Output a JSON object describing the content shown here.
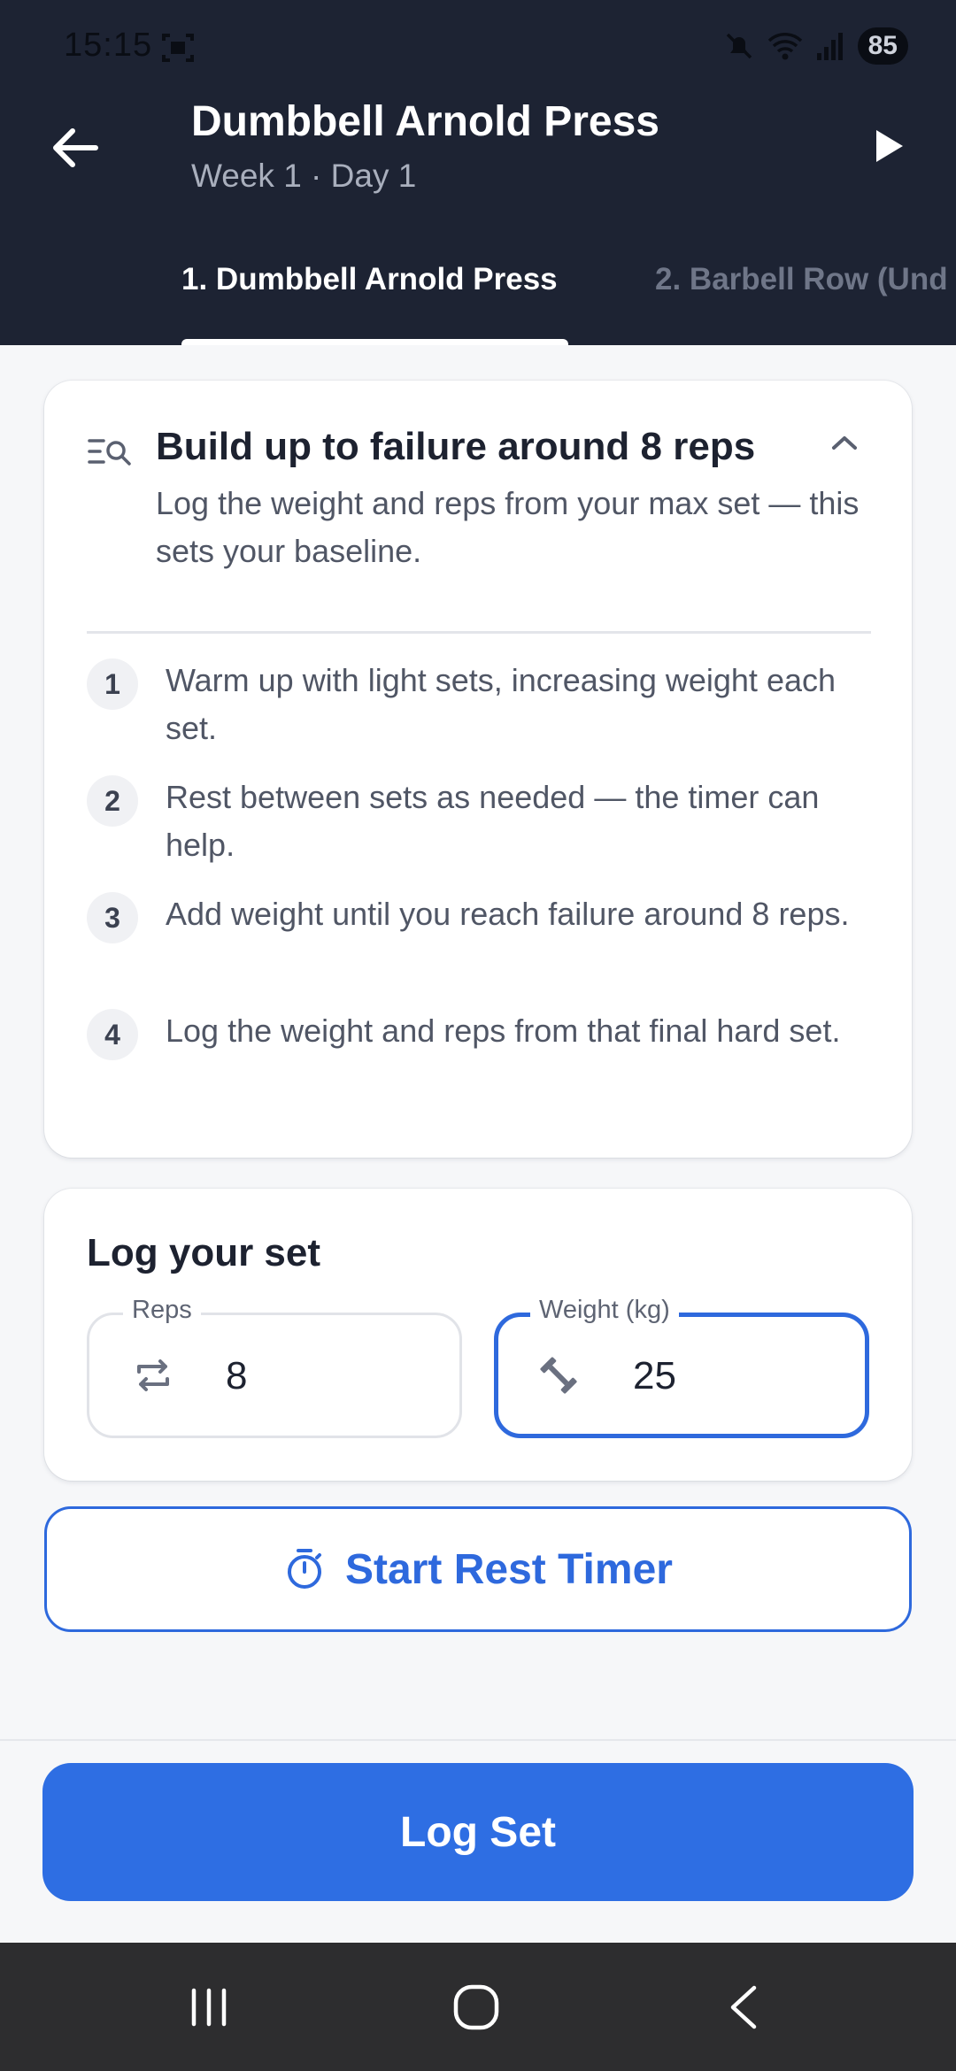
{
  "status_bar": {
    "time": "15:15",
    "battery": "85",
    "icons": [
      "screenshot-icon",
      "mute-icon",
      "wifi-icon",
      "signal-icon"
    ]
  },
  "header": {
    "title": "Dumbbell Arnold Press",
    "subtitle": "Week 1 · Day 1",
    "back_icon": "arrow-left-icon",
    "play_icon": "play-icon"
  },
  "tabs": [
    {
      "label": "1. Dumbbell Arnold Press",
      "active": true
    },
    {
      "label": "2. Barbell Row (Und",
      "active": false
    }
  ],
  "instructions": {
    "title": "Build up to failure around 8 reps",
    "description": "Log the weight and reps from your max set — this sets your baseline.",
    "steps": [
      {
        "number": "1",
        "text": "Warm up with light sets, increasing weight each set."
      },
      {
        "number": "2",
        "text": "Rest between sets as needed — the timer can help."
      },
      {
        "number": "3",
        "text": "Add weight until you reach failure around 8 reps."
      },
      {
        "number": "4",
        "text": "Log the weight and reps from that final hard set."
      }
    ]
  },
  "log": {
    "title": "Log your set",
    "reps_label": "Reps",
    "reps_value": "8",
    "weight_label": "Weight (kg)",
    "weight_value": "25"
  },
  "timer_button": {
    "label": "Start Rest Timer"
  },
  "log_button": {
    "label": "Log Set"
  },
  "colors": {
    "header_bg": "#1d2333",
    "accent": "#2e69dd",
    "primary_button": "#2e6ee3",
    "page_bg": "#f6f7f9",
    "nav_bar": "#2d2d2f"
  }
}
